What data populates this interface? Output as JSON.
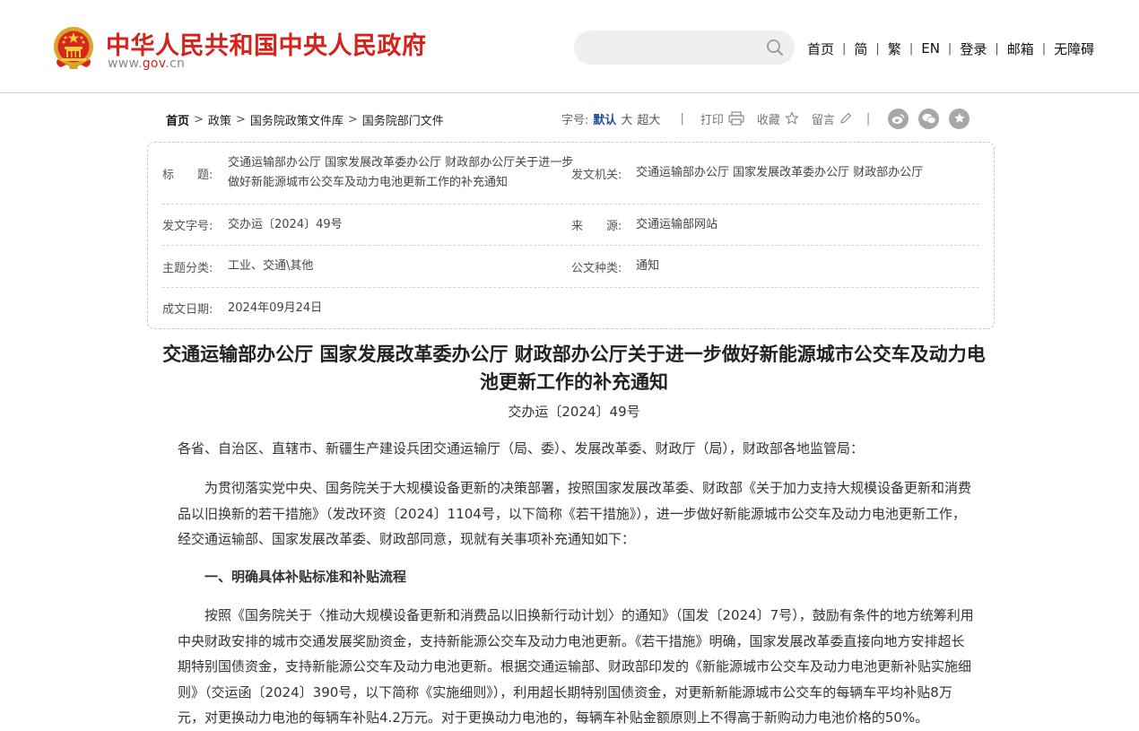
{
  "header": {
    "site_name": "中华人民共和国中央人民政府",
    "url_prefix": "www.",
    "url_highlight": "gov",
    "url_suffix": ".cn",
    "search_placeholder": "",
    "nav": [
      "首页",
      "简",
      "繁",
      "EN",
      "登录",
      "邮箱",
      "无障碍"
    ],
    "separator": "|"
  },
  "breadcrumb": {
    "items": [
      "首页",
      "政策",
      "国务院政策文件库",
      "国务院部门文件"
    ],
    "separator": ">"
  },
  "toolbar": {
    "font_size_label": "字号:",
    "font_size_options": [
      "默认",
      "大",
      "超大"
    ],
    "font_size_active": "默认",
    "divider": "|",
    "print_label": "打印",
    "favorite_label": "收藏",
    "comment_label": "留言"
  },
  "meta": {
    "title_label": "标　　题:",
    "title_value": "交通运输部办公厅 国家发展改革委办公厅 财政部办公厅关于进一步做好新能源城市公交车及动力电池更新工作的补充通知",
    "issuer_label": "发文机关:",
    "issuer_value": "交通运输部办公厅 国家发展改革委办公厅 财政部办公厅",
    "doc_no_label": "发文字号:",
    "doc_no_value": "交办运〔2024〕49号",
    "source_label": "来　　源:",
    "source_value": "交通运输部网站",
    "topic_label": "主题分类:",
    "topic_value": "工业、交通\\其他",
    "type_label": "公文种类:",
    "type_value": "通知",
    "date_label": "成文日期:",
    "date_value": "2024年09月24日"
  },
  "article": {
    "title": "交通运输部办公厅 国家发展改革委办公厅 财政部办公厅关于进一步做好新能源城市公交车及动力电池更新工作的补充通知",
    "doc_number": "交办运〔2024〕49号",
    "addressee": "各省、自治区、直辖市、新疆生产建设兵团交通运输厅（局、委）、发展改革委、财政厅（局），财政部各地监管局：",
    "intro": "为贯彻落实党中央、国务院关于大规模设备更新的决策部署，按照国家发展改革委、财政部《关于加力支持大规模设备更新和消费品以旧换新的若干措施》（发改环资〔2024〕1104号，以下简称《若干措施》），进一步做好新能源城市公交车及动力电池更新工作，经交通运输部、国家发展改革委、财政部同意，现就有关事项补充通知如下：",
    "section1_heading": "一、明确具体补贴标准和补贴流程",
    "section1_body": "按照《国务院关于〈推动大规模设备更新和消费品以旧换新行动计划〉的通知》（国发〔2024〕7号），鼓励有条件的地方统筹利用中央财政安排的城市交通发展奖励资金，支持新能源公交车及动力电池更新。《若干措施》明确，国家发展改革委直接向地方安排超长期特别国债资金，支持新能源公交车及动力电池更新。根据交通运输部、财政部印发的《新能源城市公交车及动力电池更新补贴实施细则》（交运函〔2024〕390号，以下简称《实施细则》），利用超长期特别国债资金，对更新新能源城市公交车的每辆车平均补贴8万元，对更换动力电池的每辆车补贴4.2万元。对于更换动力电池的，每辆车补贴金额原则上不得高于新购动力电池价格的50%。"
  },
  "colors": {
    "brand_red": "#d4231d",
    "active_blue": "#1f4e9a"
  },
  "icons": [
    "national-emblem-icon",
    "search-icon",
    "print-icon",
    "star-icon",
    "pencil-icon",
    "weibo-icon",
    "wechat-icon",
    "favorite-icon"
  ]
}
